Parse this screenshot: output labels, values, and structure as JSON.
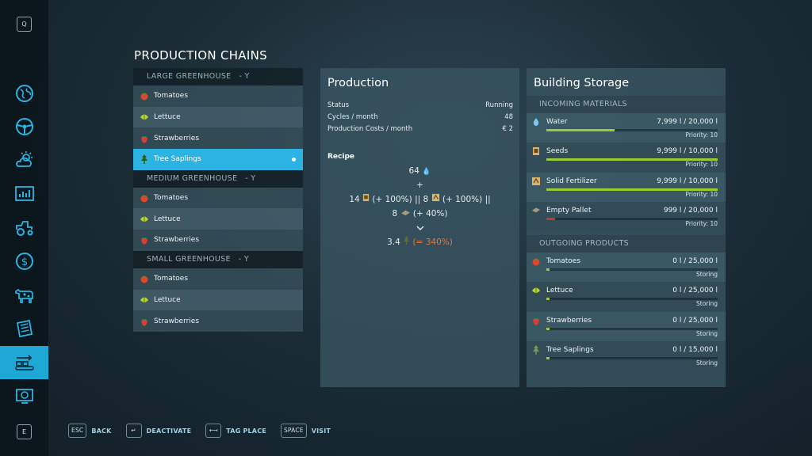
{
  "sidebar": {
    "top_key": "Q",
    "bottom_key": "E",
    "items": [
      {
        "icon": "globe-map-icon"
      },
      {
        "icon": "steering-wheel-icon"
      },
      {
        "icon": "weather-icon"
      },
      {
        "icon": "statistics-icon"
      },
      {
        "icon": "tractor-icon"
      },
      {
        "icon": "finance-icon"
      },
      {
        "icon": "animals-icon"
      },
      {
        "icon": "contracts-icon"
      },
      {
        "icon": "production-icon",
        "active": true
      },
      {
        "icon": "help-icon"
      }
    ]
  },
  "page_title": "PRODUCTION CHAINS",
  "chains": [
    {
      "name": "LARGE GREENHOUSE",
      "suffix": "- Y",
      "items": [
        {
          "label": "Tomatoes",
          "icon": "tomato-icon"
        },
        {
          "label": "Lettuce",
          "icon": "lettuce-icon"
        },
        {
          "label": "Strawberries",
          "icon": "strawberry-icon"
        },
        {
          "label": "Tree Saplings",
          "icon": "tree-sapling-icon",
          "selected": true
        }
      ]
    },
    {
      "name": "MEDIUM GREENHOUSE",
      "suffix": "- Y",
      "items": [
        {
          "label": "Tomatoes",
          "icon": "tomato-icon"
        },
        {
          "label": "Lettuce",
          "icon": "lettuce-icon"
        },
        {
          "label": "Strawberries",
          "icon": "strawberry-icon"
        }
      ]
    },
    {
      "name": "SMALL GREENHOUSE",
      "suffix": "- Y",
      "items": [
        {
          "label": "Tomatoes",
          "icon": "tomato-icon"
        },
        {
          "label": "Lettuce",
          "icon": "lettuce-icon"
        },
        {
          "label": "Strawberries",
          "icon": "strawberry-icon"
        }
      ]
    }
  ],
  "production": {
    "title": "Production",
    "stats": [
      {
        "label": "Status",
        "value": "Running"
      },
      {
        "label": "Cycles / month",
        "value": "48"
      },
      {
        "label": "Production Costs / month",
        "value": "€ 2"
      }
    ],
    "recipe_title": "Recipe",
    "recipe": {
      "water": "64",
      "plus": "+",
      "seeds": "14",
      "seeds_bonus": "(+ 100%)",
      "separator": "||",
      "fertilizer": "8",
      "fertilizer_bonus": "(+ 100%)",
      "separator2": "||",
      "pallet": "8",
      "pallet_bonus": "(+ 40%)",
      "output": "3.4",
      "output_bonus": "(= 340%)"
    }
  },
  "storage": {
    "title": "Building Storage",
    "incoming_label": "INCOMING MATERIALS",
    "incoming": [
      {
        "name": "Water",
        "icon": "water-drop-icon",
        "amount": "7,999 l / 20,000 l",
        "fill": 0.4,
        "status": "Priority: 10"
      },
      {
        "name": "Seeds",
        "icon": "seeds-icon",
        "amount": "9,999 l / 10,000 l",
        "fill": 1.0,
        "status": "Priority: 10"
      },
      {
        "name": "Solid Fertilizer",
        "icon": "fertilizer-icon",
        "amount": "9,999 l / 10,000 l",
        "fill": 1.0,
        "status": "Priority: 10"
      },
      {
        "name": "Empty Pallet",
        "icon": "pallet-icon",
        "amount": "999 l / 20,000 l",
        "fill": 0.05,
        "low": true,
        "status": "Priority: 10"
      }
    ],
    "outgoing_label": "OUTGOING PRODUCTS",
    "outgoing": [
      {
        "name": "Tomatoes",
        "icon": "tomato-icon",
        "amount": "0 l / 25,000 l",
        "fill": 0.01,
        "status": "Storing"
      },
      {
        "name": "Lettuce",
        "icon": "lettuce-icon",
        "amount": "0 l / 25,000 l",
        "fill": 0.01,
        "status": "Storing"
      },
      {
        "name": "Strawberries",
        "icon": "strawberry-icon",
        "amount": "0 l / 25,000 l",
        "fill": 0.01,
        "status": "Storing"
      },
      {
        "name": "Tree Saplings",
        "icon": "tree-sapling-icon",
        "amount": "0 l / 15,000 l",
        "fill": 0.01,
        "status": "Storing"
      }
    ]
  },
  "footer": [
    {
      "key": "ESC",
      "label": "BACK"
    },
    {
      "key": "↵",
      "label": "DEACTIVATE"
    },
    {
      "key": "⟻",
      "label": "TAG PLACE"
    },
    {
      "key": "SPACE",
      "label": "VISIT"
    }
  ]
}
